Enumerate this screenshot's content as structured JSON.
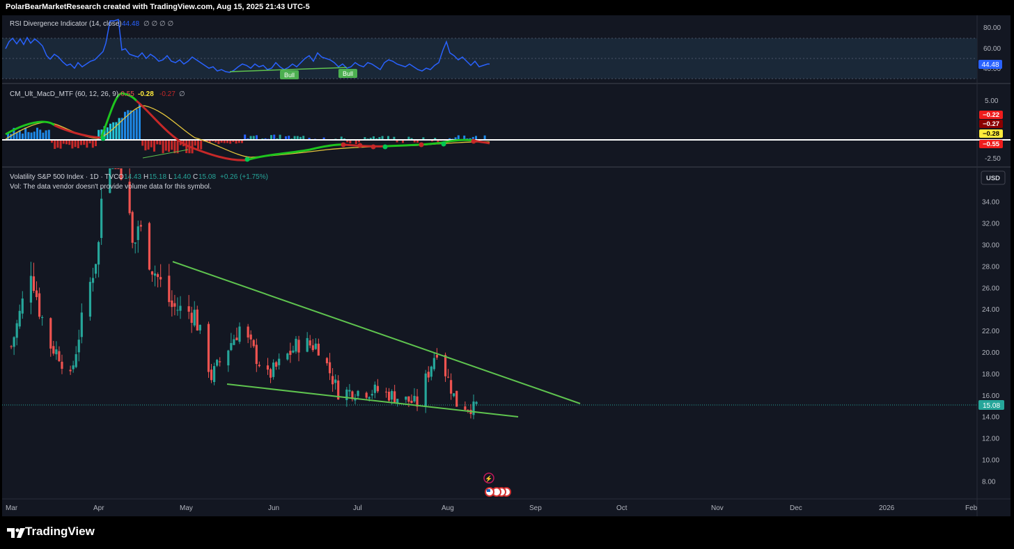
{
  "header": {
    "caption": "PolarBearMarketResearch created with TradingView.com, Aug 15, 2025 21:43 UTC-5"
  },
  "footer": {
    "brand": "TradingView"
  },
  "colors": {
    "background": "#131722",
    "up": "#26a69a",
    "down": "#ef5350",
    "trendline": "#5fc44f",
    "rsi": "#2962ff",
    "macd_up": "#00c853",
    "macd_down": "#c62828",
    "signal": "#ffeb3b"
  },
  "rsi_pane": {
    "title": "RSI Divergence Indicator (14, close)",
    "value_label": "44.48",
    "nulls": "∅ ∅ ∅ ∅",
    "axis_ticks": [
      "80.00",
      "60.00",
      "40.00"
    ],
    "tag": "44.48",
    "bull_labels": [
      "Bull",
      "Bull"
    ]
  },
  "macd_pane": {
    "title": "CM_Ult_MacD_MTF (60, 12, 26, 9)",
    "v1": "-0.55",
    "v2": "-0.28",
    "v3": "-0.27",
    "nulls": "∅",
    "axis_ticks": [
      "5.00",
      "-2.50"
    ],
    "tags": [
      "−0.22",
      "−0.27",
      "−0.28",
      "−0.55"
    ]
  },
  "price_pane": {
    "title": "Volatility S&P 500 Index · 1D · TVC",
    "open_label": "O",
    "open": "14.43",
    "high_label": "H",
    "high": "15.18",
    "low_label": "L",
    "low": "14.40",
    "close_label": "C",
    "close": "15.08",
    "change": "+0.26 (+1.75%)",
    "vol_note": "Vol: The data vendor doesn't provide volume data for this symbol.",
    "currency": "USD",
    "last_tag": "15.08",
    "axis_ticks": [
      "34.00",
      "32.00",
      "30.00",
      "28.00",
      "26.00",
      "24.00",
      "22.00",
      "20.00",
      "18.00",
      "16.00",
      "14.00",
      "12.00",
      "10.00",
      "8.00"
    ]
  },
  "time_axis": [
    "Mar",
    "Apr",
    "May",
    "Jun",
    "Jul",
    "Aug",
    "Sep",
    "Oct",
    "Nov",
    "Dec",
    "2026",
    "Feb"
  ],
  "chart_data": {
    "type": "candlestick",
    "title": "Volatility S&P 500 Index · 1D · TVC",
    "x_range": [
      "2025-03-01",
      "2026-02-01"
    ],
    "ylim": [
      7,
      36
    ],
    "ohlc_approx": [
      {
        "x": "2025-03-03",
        "o": 21.5,
        "h": 23,
        "l": 19.5,
        "c": 20.5
      },
      {
        "x": "2025-03-06",
        "o": 21,
        "h": 24.6,
        "l": 20.5,
        "c": 23.5
      },
      {
        "x": "2025-03-10",
        "o": 23,
        "h": 29.6,
        "l": 22.8,
        "c": 27.9
      },
      {
        "x": "2025-03-13",
        "o": 24.5,
        "h": 26,
        "l": 23.2,
        "c": 24
      },
      {
        "x": "2025-03-17",
        "o": 22,
        "h": 23.5,
        "l": 20.4,
        "c": 20.6
      },
      {
        "x": "2025-03-20",
        "o": 20.5,
        "h": 22,
        "l": 19.6,
        "c": 19.8
      },
      {
        "x": "2025-03-24",
        "o": 18.3,
        "h": 19.6,
        "l": 17,
        "c": 17.5
      },
      {
        "x": "2025-03-27",
        "o": 19,
        "h": 21.8,
        "l": 18.7,
        "c": 21.6
      },
      {
        "x": "2025-04-03",
        "o": 22,
        "h": 30.1,
        "l": 21.8,
        "c": 30
      },
      {
        "x": "2025-04-08",
        "o": 46,
        "h": 60,
        "l": 31,
        "c": 52
      },
      {
        "x": "2025-04-11",
        "o": 40,
        "h": 45,
        "l": 33,
        "c": 37.6
      },
      {
        "x": "2025-04-16",
        "o": 30,
        "h": 33,
        "l": 28.5,
        "c": 32.6
      },
      {
        "x": "2025-04-22",
        "o": 30,
        "h": 30.6,
        "l": 27,
        "c": 28
      },
      {
        "x": "2025-04-29",
        "o": 24.5,
        "h": 25.5,
        "l": 23.5,
        "c": 24.2
      },
      {
        "x": "2025-05-07",
        "o": 23.5,
        "h": 24.5,
        "l": 22.4,
        "c": 23.6
      },
      {
        "x": "2025-05-13",
        "o": 18.2,
        "h": 19,
        "l": 17.3,
        "c": 17.7
      },
      {
        "x": "2025-05-23",
        "o": 22,
        "h": 25.5,
        "l": 20.4,
        "c": 22.3
      },
      {
        "x": "2025-06-02",
        "o": 18.6,
        "h": 19.5,
        "l": 17.5,
        "c": 17.7
      },
      {
        "x": "2025-06-13",
        "o": 19.5,
        "h": 21.6,
        "l": 19.2,
        "c": 20.8
      },
      {
        "x": "2025-06-20",
        "o": 20.5,
        "h": 22.3,
        "l": 20,
        "c": 20.6
      },
      {
        "x": "2025-06-27",
        "o": 16.5,
        "h": 17.2,
        "l": 16.2,
        "c": 16.3
      },
      {
        "x": "2025-07-11",
        "o": 16.5,
        "h": 17.5,
        "l": 16.3,
        "c": 16.4
      },
      {
        "x": "2025-07-25",
        "o": 15.6,
        "h": 16.5,
        "l": 15.2,
        "c": 15.2
      },
      {
        "x": "2025-08-01",
        "o": 17,
        "h": 21.9,
        "l": 16.5,
        "c": 20.4
      },
      {
        "x": "2025-08-08",
        "o": 16.8,
        "h": 17.3,
        "l": 15.1,
        "c": 15.2
      },
      {
        "x": "2025-08-14",
        "o": 14.5,
        "h": 15.2,
        "l": 14.4,
        "c": 14.8
      },
      {
        "x": "2025-08-15",
        "o": 14.43,
        "h": 15.18,
        "l": 14.4,
        "c": 15.08
      }
    ],
    "trendlines": [
      {
        "name": "upper",
        "from": {
          "x": "2025-04-29",
          "y": 28.2
        },
        "to": {
          "x": "2025-09-17",
          "y": 15.2
        }
      },
      {
        "name": "lower",
        "from": {
          "x": "2025-05-13",
          "y": 17.0
        },
        "to": {
          "x": "2025-08-30",
          "y": 14.0
        }
      }
    ],
    "rsi": {
      "ylim": [
        30,
        95
      ],
      "last": 44.48
    },
    "macd": {
      "ylim": [
        -4.5,
        8
      ],
      "values": [
        -0.55,
        -0.28,
        -0.27,
        -0.22
      ]
    }
  }
}
